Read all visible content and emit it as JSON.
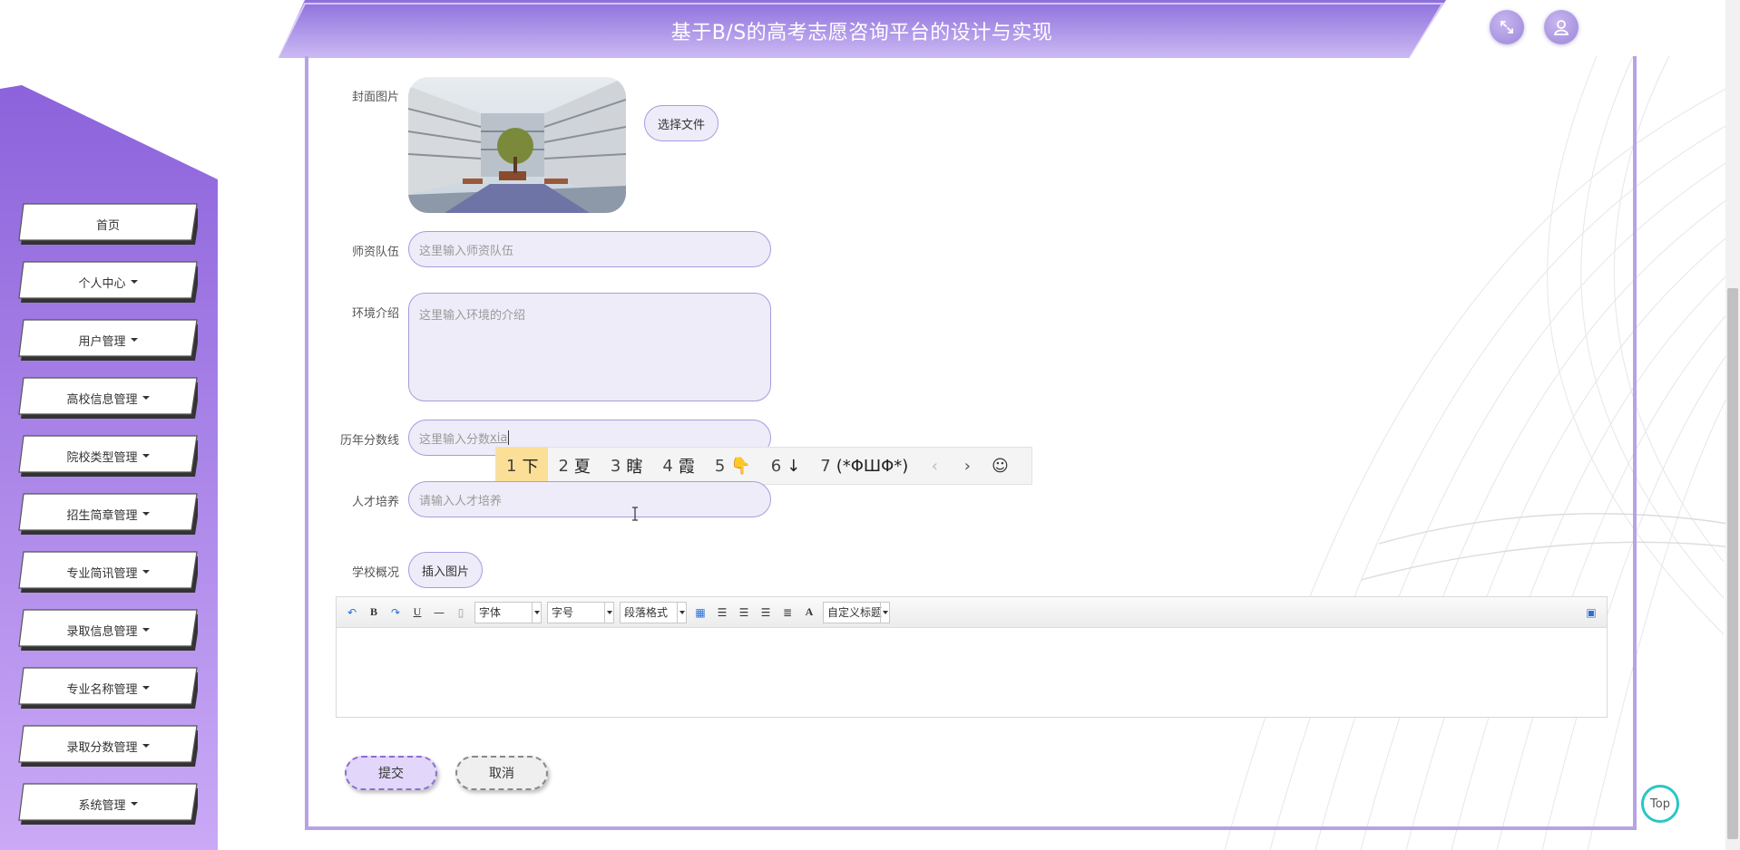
{
  "header": {
    "title": "基于B/S的高考志愿咨询平台的设计与实现",
    "fullscreen_icon": "fullscreen-icon",
    "user_icon": "user-icon"
  },
  "sidebar": {
    "items": [
      {
        "label": "首页",
        "has_dropdown": false
      },
      {
        "label": "个人中心",
        "has_dropdown": true
      },
      {
        "label": "用户管理",
        "has_dropdown": true
      },
      {
        "label": "高校信息管理",
        "has_dropdown": true
      },
      {
        "label": "院校类型管理",
        "has_dropdown": true
      },
      {
        "label": "招生简章管理",
        "has_dropdown": true
      },
      {
        "label": "专业简讯管理",
        "has_dropdown": true
      },
      {
        "label": "录取信息管理",
        "has_dropdown": true
      },
      {
        "label": "专业名称管理",
        "has_dropdown": true
      },
      {
        "label": "录取分数管理",
        "has_dropdown": true
      },
      {
        "label": "系统管理",
        "has_dropdown": true
      }
    ]
  },
  "form": {
    "cover": {
      "label": "封面图片",
      "button": "选择文件"
    },
    "faculty": {
      "label": "师资队伍",
      "placeholder": "这里输入师资队伍"
    },
    "environment": {
      "label": "环境介绍",
      "placeholder": "这里输入环境的介绍"
    },
    "score_lines": {
      "label": "历年分数线",
      "placeholder": "这里输入分数",
      "typed": "xia"
    },
    "talent": {
      "label": "人才培养",
      "placeholder": "请输入人才培养"
    },
    "overview": {
      "label": "学校概况",
      "button": "插入图片"
    }
  },
  "editor": {
    "toolbar": {
      "font": "字体",
      "size": "字号",
      "paragraph": "段落格式",
      "custom_title": "自定义标题"
    }
  },
  "ime": {
    "candidates": [
      {
        "n": "1",
        "text": "下"
      },
      {
        "n": "2",
        "text": "夏"
      },
      {
        "n": "3",
        "text": "瞎"
      },
      {
        "n": "4",
        "text": "霞"
      },
      {
        "n": "5",
        "text": "👇"
      },
      {
        "n": "6",
        "text": "↓"
      },
      {
        "n": "7",
        "text": "(*ΦШΦ*)"
      }
    ],
    "prev": "‹",
    "next": "›",
    "emoji": "☺"
  },
  "actions": {
    "submit": "提交",
    "cancel": "取消"
  },
  "top_button": "Top",
  "colors": {
    "accent": "#9d86e0",
    "accent_light": "#d9cdf7",
    "ime_highlight": "#fbdf97",
    "top_ring": "#2bc6c6"
  }
}
